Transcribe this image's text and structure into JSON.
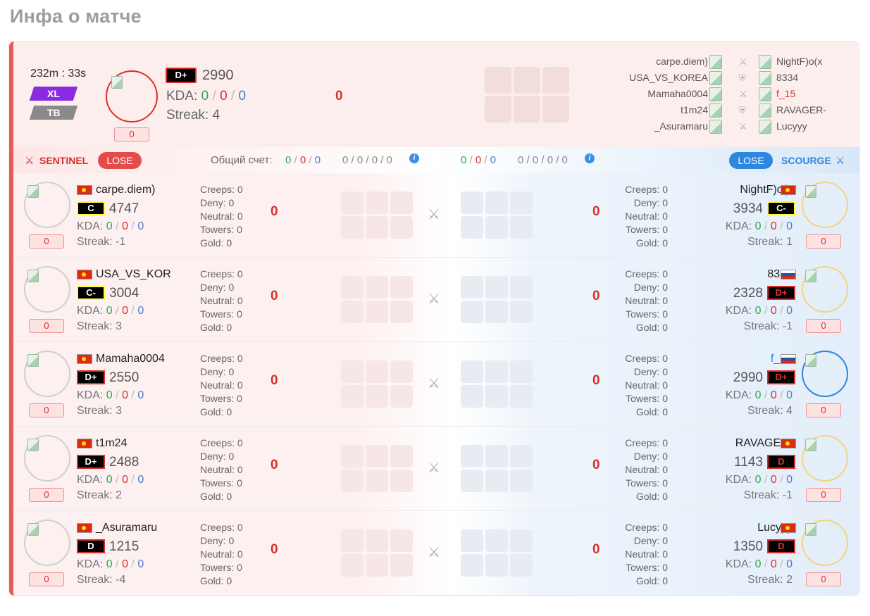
{
  "page_title": "Инфа о матче",
  "header": {
    "duration": "232m : 33s",
    "tags": [
      "XL",
      "TB"
    ],
    "hero_score": "0",
    "rank": "D+",
    "rating": "2990",
    "kda_label": "KDA:",
    "kda": {
      "k": "0",
      "d": "0",
      "a": "0"
    },
    "streak": "Streak: 4",
    "center_value": "0",
    "matchups": [
      {
        "left": "carpe.diem)",
        "right": "NightF)o(x",
        "icon": "swords-icon",
        "right_highlight": false
      },
      {
        "left": "USA_VS_KOREA",
        "right": "8334",
        "icon": "shield-icon",
        "right_highlight": false
      },
      {
        "left": "Mamaha0004",
        "right": "f_15",
        "icon": "swords-icon",
        "right_highlight": true
      },
      {
        "left": "t1m24",
        "right": "RAVAGER-",
        "icon": "shield-icon",
        "right_highlight": false
      },
      {
        "left": "_Asuramaru",
        "right": "Lucyyy",
        "icon": "swords-icon",
        "right_highlight": false
      }
    ]
  },
  "teambar": {
    "sentinel": "SENTINEL",
    "scourge": "SCOURGE",
    "left_result": "LOSE",
    "right_result": "LOSE",
    "total_label": "Общий счет:",
    "left_kda": {
      "k": "0",
      "d": "0",
      "a": "0"
    },
    "left_extra": "0 / 0 / 0 / 0",
    "right_kda": {
      "k": "0",
      "d": "0",
      "a": "0"
    },
    "right_extra": "0 / 0 / 0 / 0",
    "info": "i",
    "colors": {
      "sentinel": "#d9302c",
      "scourge": "#2e86de"
    }
  },
  "players": [
    {
      "left": {
        "name": "carpe.diem)",
        "flag": "cn",
        "rank": "C",
        "rank_class": "c",
        "rating": "4747",
        "kda": {
          "k": "0",
          "d": "0",
          "a": "0"
        },
        "streak": "Streak: -1",
        "score": "0",
        "stats": [
          "Creeps: 0",
          "Deny: 0",
          "Neutral: 0",
          "Towers: 0",
          "Gold: 0"
        ],
        "zero": "0"
      },
      "right": {
        "name": "NightF)o(x",
        "flag": "cn",
        "rank": "C-",
        "rank_class": "c",
        "rating": "3934",
        "kda": {
          "k": "0",
          "d": "0",
          "a": "0"
        },
        "streak": "Streak: 1",
        "score": "0",
        "stats": [
          "Creeps: 0",
          "Deny: 0",
          "Neutral: 0",
          "Towers: 0",
          "Gold: 0"
        ],
        "zero": "0",
        "ring": "gold",
        "highlight": false
      }
    },
    {
      "left": {
        "name": "USA_VS_KOR",
        "flag": "cn",
        "rank": "C-",
        "rank_class": "c",
        "rating": "3004",
        "kda": {
          "k": "0",
          "d": "0",
          "a": "0"
        },
        "streak": "Streak: 3",
        "score": "0",
        "stats": [
          "Creeps: 0",
          "Deny: 0",
          "Neutral: 0",
          "Towers: 0",
          "Gold: 0"
        ],
        "zero": "0"
      },
      "right": {
        "name": "8334",
        "flag": "ru",
        "rank": "D+",
        "rank_class": "",
        "rating": "2328",
        "kda": {
          "k": "0",
          "d": "0",
          "a": "0"
        },
        "streak": "Streak: -1",
        "score": "0",
        "stats": [
          "Creeps: 0",
          "Deny: 0",
          "Neutral: 0",
          "Towers: 0",
          "Gold: 0"
        ],
        "zero": "0",
        "ring": "gold",
        "highlight": false
      }
    },
    {
      "left": {
        "name": "Mamaha0004",
        "flag": "cn",
        "rank": "D+",
        "rank_class": "",
        "rating": "2550",
        "kda": {
          "k": "0",
          "d": "0",
          "a": "0"
        },
        "streak": "Streak: 3",
        "score": "0",
        "stats": [
          "Creeps: 0",
          "Deny: 0",
          "Neutral: 0",
          "Towers: 0",
          "Gold: 0"
        ],
        "zero": "0"
      },
      "right": {
        "name": "f_15",
        "flag": "ru",
        "rank": "D+",
        "rank_class": "",
        "rating": "2990",
        "kda": {
          "k": "0",
          "d": "0",
          "a": "0"
        },
        "streak": "Streak: 4",
        "score": "0",
        "stats": [
          "Creeps: 0",
          "Deny: 0",
          "Neutral: 0",
          "Towers: 0",
          "Gold: 0"
        ],
        "zero": "0",
        "ring": "blue",
        "highlight": true
      }
    },
    {
      "left": {
        "name": "t1m24",
        "flag": "cn",
        "rank": "D+",
        "rank_class": "",
        "rating": "2488",
        "kda": {
          "k": "0",
          "d": "0",
          "a": "0"
        },
        "streak": "Streak: 2",
        "score": "0",
        "stats": [
          "Creeps: 0",
          "Deny: 0",
          "Neutral: 0",
          "Towers: 0",
          "Gold: 0"
        ],
        "zero": "0"
      },
      "right": {
        "name": "RAVAGER-",
        "flag": "cn",
        "rank": "D",
        "rank_class": "",
        "rating": "1143",
        "kda": {
          "k": "0",
          "d": "0",
          "a": "0"
        },
        "streak": "Streak: -1",
        "score": "0",
        "stats": [
          "Creeps: 0",
          "Deny: 0",
          "Neutral: 0",
          "Towers: 0",
          "Gold: 0"
        ],
        "zero": "0",
        "ring": "gold",
        "highlight": false
      }
    },
    {
      "left": {
        "name": "_Asuramaru",
        "flag": "cn",
        "rank": "D",
        "rank_class": "",
        "rating": "1215",
        "kda": {
          "k": "0",
          "d": "0",
          "a": "0"
        },
        "streak": "Streak: -4",
        "score": "0",
        "stats": [
          "Creeps: 0",
          "Deny: 0",
          "Neutral: 0",
          "Towers: 0",
          "Gold: 0"
        ],
        "zero": "0"
      },
      "right": {
        "name": "Lucyyy",
        "flag": "cn",
        "rank": "D",
        "rank_class": "",
        "rating": "1350",
        "kda": {
          "k": "0",
          "d": "0",
          "a": "0"
        },
        "streak": "Streak: 2",
        "score": "0",
        "stats": [
          "Creeps: 0",
          "Deny: 0",
          "Neutral: 0",
          "Towers: 0",
          "Gold: 0"
        ],
        "zero": "0",
        "ring": "gold",
        "highlight": false
      }
    }
  ]
}
